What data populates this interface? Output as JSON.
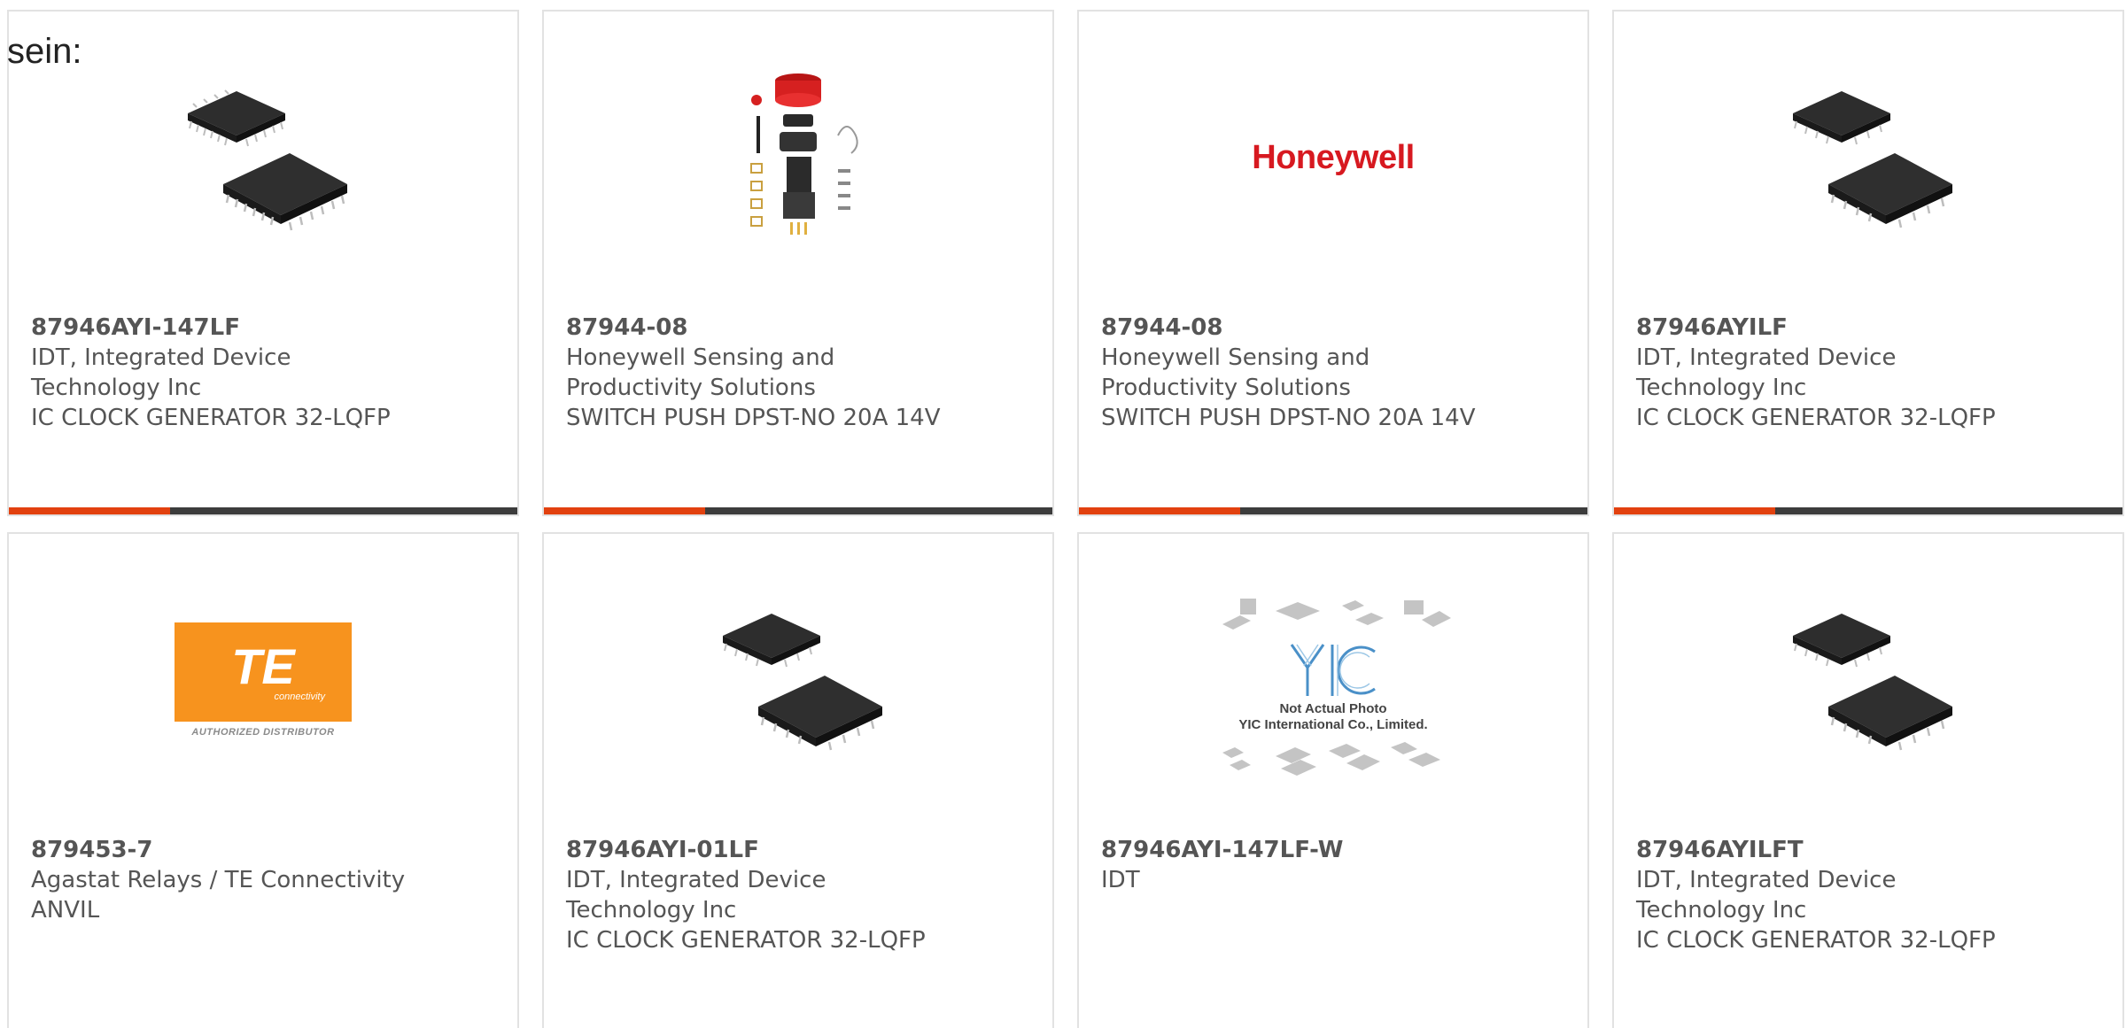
{
  "intro_text": "sein:",
  "colors": {
    "accent": "#e2410f",
    "bar": "#3c3c3c",
    "border": "#e2e2e2",
    "text": "#555555"
  },
  "products": [
    {
      "part_number": "87946AYI-147LF",
      "manufacturer_line1": "IDT, Integrated Device",
      "manufacturer_line2": "Technology Inc",
      "description": "IC CLOCK GENERATOR 32-LQFP",
      "image": "lqfp-chip-image"
    },
    {
      "part_number": "87944-08",
      "manufacturer_line1": "Honeywell Sensing and",
      "manufacturer_line2": "Productivity Solutions",
      "description": "SWITCH PUSH DPST-NO 20A 14V",
      "image": "push-switch-parts-image"
    },
    {
      "part_number": "87944-08",
      "manufacturer_line1": "Honeywell Sensing and",
      "manufacturer_line2": "Productivity Solutions",
      "description": "SWITCH PUSH DPST-NO 20A 14V",
      "image": "honeywell-logo",
      "logo_text": "Honeywell"
    },
    {
      "part_number": "87946AYILF",
      "manufacturer_line1": "IDT, Integrated Device",
      "manufacturer_line2": "Technology Inc",
      "description": "IC CLOCK GENERATOR 32-LQFP",
      "image": "lqfp-chip-image"
    },
    {
      "part_number": "879453-7",
      "manufacturer_line1": "Agastat Relays / TE Connectivity",
      "manufacturer_line2": "ANVIL",
      "description": "",
      "image": "te-connectivity-logo",
      "logo_text": "TE",
      "logo_sub": "connectivity",
      "logo_caption": "AUTHORIZED DISTRIBUTOR"
    },
    {
      "part_number": "87946AYI-01LF",
      "manufacturer_line1": "IDT, Integrated Device",
      "manufacturer_line2": "Technology Inc",
      "description": "IC CLOCK GENERATOR 32-LQFP",
      "image": "lqfp-chip-image"
    },
    {
      "part_number": "87946AYI-147LF-W",
      "manufacturer_line1": "IDT",
      "manufacturer_line2": "",
      "description": "",
      "image": "yic-placeholder-image",
      "logo_text": "YIC",
      "logo_caption1": "Not Actual Photo",
      "logo_caption2": "YIC International Co., Limited."
    },
    {
      "part_number": "87946AYILFT",
      "manufacturer_line1": "IDT, Integrated Device",
      "manufacturer_line2": "Technology Inc",
      "description": "IC CLOCK GENERATOR 32-LQFP",
      "image": "lqfp-chip-image"
    }
  ]
}
